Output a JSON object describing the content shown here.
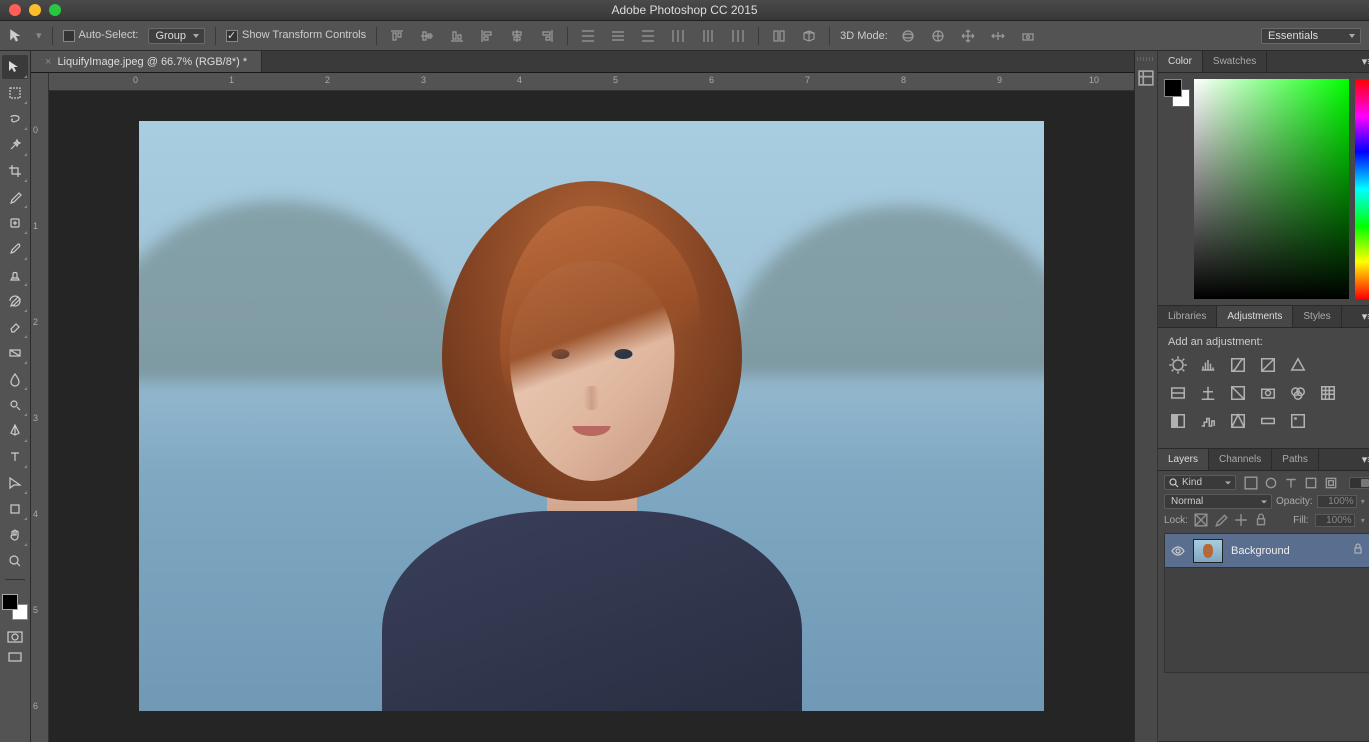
{
  "app_title": "Adobe Photoshop CC 2015",
  "options_bar": {
    "auto_select_label": "Auto-Select:",
    "auto_select_checked": false,
    "layer_target": "Group",
    "show_transform_label": "Show Transform Controls",
    "show_transform_checked": true,
    "mode_3d_label": "3D Mode:"
  },
  "workspace": {
    "name": "Essentials"
  },
  "document": {
    "tab_label": "LiquifyImage.jpeg @ 66.7% (RGB/8*) *",
    "ruler_h": [
      "0",
      "1",
      "2",
      "3",
      "4",
      "5",
      "6",
      "7",
      "8",
      "9",
      "10"
    ],
    "ruler_v": [
      "0",
      "1",
      "2",
      "3",
      "4",
      "5",
      "6"
    ]
  },
  "panels": {
    "color": {
      "tabs": [
        "Color",
        "Swatches"
      ],
      "active": "Color"
    },
    "adjustments": {
      "tabs": [
        "Libraries",
        "Adjustments",
        "Styles"
      ],
      "active": "Adjustments",
      "heading": "Add an adjustment:"
    },
    "layers": {
      "tabs": [
        "Layers",
        "Channels",
        "Paths"
      ],
      "active": "Layers",
      "filter_kind": "Kind",
      "blend_mode": "Normal",
      "opacity_label": "Opacity:",
      "opacity_value": "100%",
      "lock_label": "Lock:",
      "fill_label": "Fill:",
      "fill_value": "100%",
      "items": [
        {
          "name": "Background",
          "locked": true,
          "visible": true
        }
      ]
    }
  }
}
